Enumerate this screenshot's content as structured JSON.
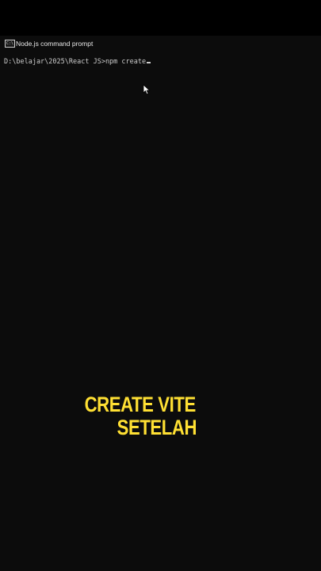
{
  "window": {
    "title": "Node.js command prompt",
    "icon": "cmd-window-icon",
    "icon_glyph": "C:\\"
  },
  "console": {
    "prompt": "D:\\belajar\\2025\\React JS>",
    "command": "npm create"
  },
  "overlay": {
    "caption_line_1": "CREATE VITE",
    "caption_line_2": "SETELAH",
    "caption_color": "#ffe033"
  },
  "colors": {
    "console_background": "#0c0c0c",
    "console_text": "#cccccc"
  }
}
